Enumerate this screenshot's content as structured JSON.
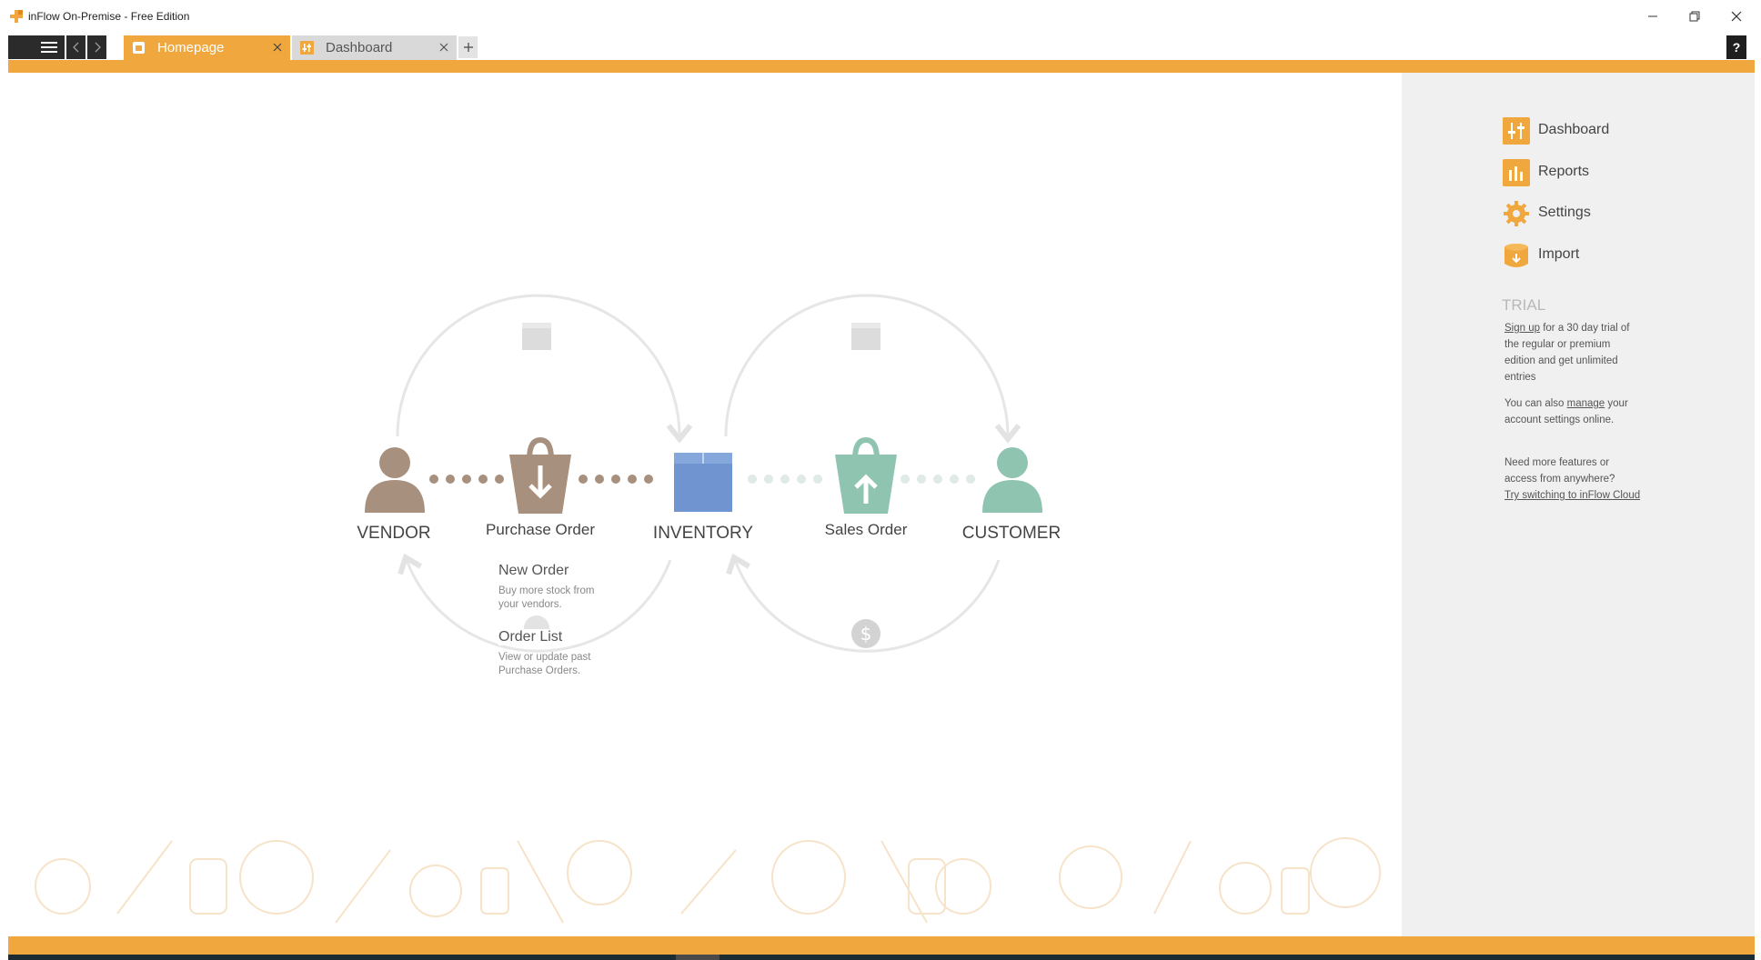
{
  "window": {
    "title": "inFlow On-Premise - Free Edition"
  },
  "tabs": [
    {
      "label": "Homepage",
      "active": true,
      "icon": "home-icon"
    },
    {
      "label": "Dashboard",
      "active": false,
      "icon": "dashboard-icon"
    }
  ],
  "help_label": "?",
  "colors": {
    "accent": "#f0a83e",
    "vendor": "#a8907f",
    "inventory": "#6f94cf",
    "customer": "#8fc4b0",
    "panel_bg": "#f0f0f0",
    "arc": "#e3e3e3"
  },
  "diagram": {
    "vendor_label": "VENDOR",
    "purchase_order_label": "Purchase Order",
    "inventory_label": "INVENTORY",
    "sales_order_label": "Sales Order",
    "customer_label": "CUSTOMER",
    "purchase_actions": [
      {
        "title": "New Order",
        "desc_lines": [
          "Buy more stock from",
          "your vendors."
        ]
      },
      {
        "title": "Order List",
        "desc_lines": [
          "View or update past",
          "Purchase Orders."
        ]
      }
    ]
  },
  "sidebar": {
    "items": [
      {
        "label": "Dashboard",
        "icon": "dashboard-icon"
      },
      {
        "label": "Reports",
        "icon": "reports-icon"
      },
      {
        "label": "Settings",
        "icon": "gear-icon"
      },
      {
        "label": "Import",
        "icon": "import-icon"
      }
    ],
    "trial": {
      "title": "TRIAL",
      "signup_link": "Sign up",
      "signup_rest_first": "for a 30 day trial of",
      "signup_rest_lines": [
        "the regular or premium",
        "edition and get unlimited",
        "entries"
      ],
      "manage_prefix": "You can also",
      "manage_link": "manage",
      "manage_suffix": "your",
      "manage_line2": "account settings online.",
      "more_lines": [
        "Need more features or",
        "access from anywhere?"
      ],
      "cloud_link": "Try switching to inFlow Cloud"
    }
  }
}
